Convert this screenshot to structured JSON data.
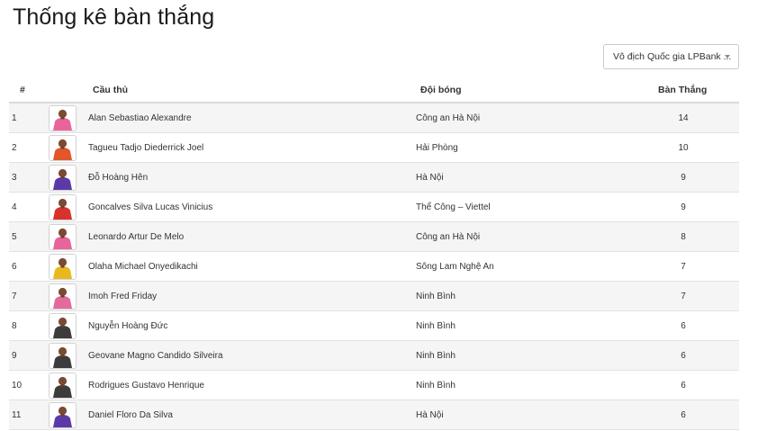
{
  "page": {
    "title": "Thống kê bàn thắng"
  },
  "league_select": {
    "value": "Vô địch Quốc gia LPBank ..."
  },
  "table": {
    "headers": {
      "rank": "#",
      "player": "Cầu thủ",
      "team": "Đội bóng",
      "goals": "Bàn Thắng"
    },
    "rows": [
      {
        "rank": "1",
        "name": "Alan Sebastiao Alexandre",
        "team": "Công an Hà Nội",
        "goals": "14",
        "kit_color": "#e9649a"
      },
      {
        "rank": "2",
        "name": "Tagueu Tadjo Diederrick Joel",
        "team": "Hải Phòng",
        "goals": "10",
        "kit_color": "#e2562b"
      },
      {
        "rank": "3",
        "name": "Đỗ Hoàng Hên",
        "team": "Hà Nội",
        "goals": "9",
        "kit_color": "#5b3aa8"
      },
      {
        "rank": "4",
        "name": "Goncalves Silva Lucas Vinicius",
        "team": "Thể Công – Viettel",
        "goals": "9",
        "kit_color": "#d8322c"
      },
      {
        "rank": "5",
        "name": "Leonardo Artur De Melo",
        "team": "Công an Hà Nội",
        "goals": "8",
        "kit_color": "#e9649a"
      },
      {
        "rank": "6",
        "name": "Olaha Michael Onyedikachi",
        "team": "Sông Lam Nghệ An",
        "goals": "7",
        "kit_color": "#e8b81e"
      },
      {
        "rank": "7",
        "name": "Imoh Fred Friday",
        "team": "Ninh Bình",
        "goals": "7",
        "kit_color": "#e26a9c"
      },
      {
        "rank": "8",
        "name": "Nguyễn Hoàng Đức",
        "team": "Ninh Bình",
        "goals": "6",
        "kit_color": "#3c3c3c"
      },
      {
        "rank": "9",
        "name": "Geovane Magno Candido Silveira",
        "team": "Ninh Bình",
        "goals": "6",
        "kit_color": "#3c3c3c"
      },
      {
        "rank": "10",
        "name": "Rodrigues Gustavo Henrique",
        "team": "Ninh Bình",
        "goals": "6",
        "kit_color": "#3c3c3c"
      },
      {
        "rank": "11",
        "name": "Daniel Floro Da Silva",
        "team": "Hà Nội",
        "goals": "6",
        "kit_color": "#5b3aa8"
      }
    ]
  }
}
